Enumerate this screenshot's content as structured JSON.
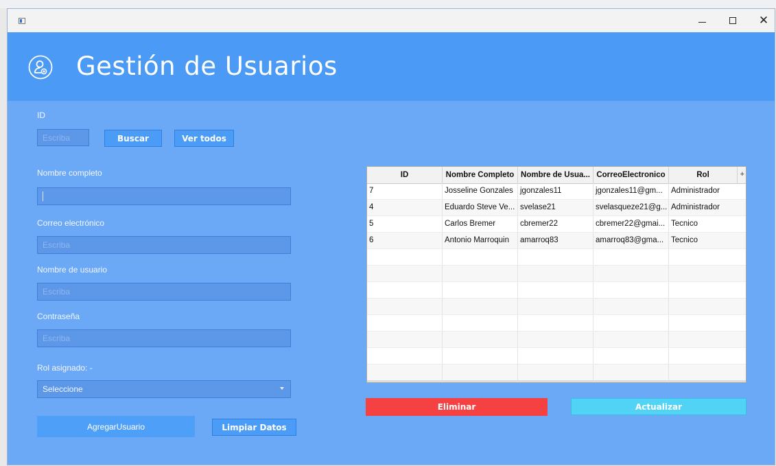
{
  "header": {
    "title": "Gestión de Usuarios",
    "icon": "user-add-icon"
  },
  "form": {
    "id_label": "ID",
    "id_placeholder": "Escriba",
    "search_button": "Buscar",
    "view_all_button": "Ver todos",
    "fullname_label": "Nombre completo",
    "fullname_value": "",
    "email_label": "Correo electrónico",
    "email_placeholder": "Escriba",
    "username_label": "Nombre de usuario",
    "username_placeholder": "Escriba",
    "password_label": "Contraseña",
    "password_placeholder": "Escriba",
    "role_label": "Rol asignado:  -",
    "role_select_value": "Seleccione",
    "add_button": "AgregarUsuario",
    "clear_button": "Limpiar Datos"
  },
  "table": {
    "columns": [
      "ID",
      "Nombre Completo",
      "Nombre de Usua...",
      "CorreoElectronico",
      "Rol"
    ],
    "add_column_symbol": "+",
    "rows": [
      [
        "7",
        "Josseline Gonzales",
        "jgonzales11",
        "jgonzales11@gm...",
        "Administrador"
      ],
      [
        "4",
        "Eduardo Steve Ve...",
        "svelase21",
        "svelasqueze21@g...",
        "Administrador"
      ],
      [
        "5",
        "Carlos Bremer",
        "cbremer22",
        "cbremer22@gmai...",
        "Tecnico"
      ],
      [
        "6",
        "Antonio Marroquin",
        "amarroq83",
        "amarroq83@gma...",
        "Tecnico"
      ]
    ]
  },
  "actions": {
    "delete_button": "Eliminar",
    "update_button": "Actualizar"
  },
  "colors": {
    "window_bg": "#6ba8f6",
    "header_bg": "#4b9bf6",
    "delete": "#f64142",
    "update": "#51d3f6"
  }
}
